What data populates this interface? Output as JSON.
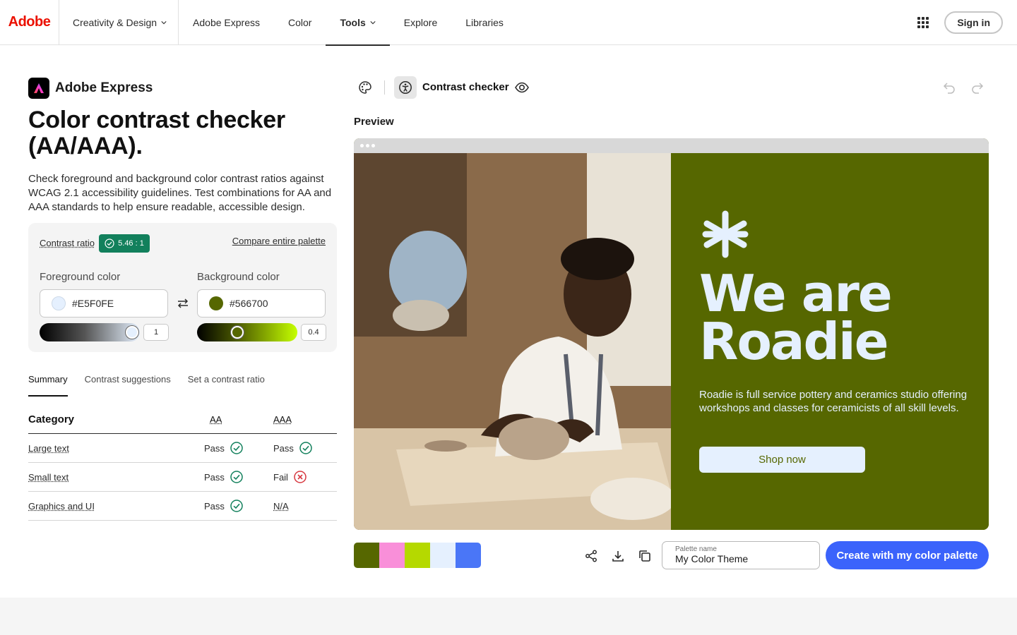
{
  "nav": {
    "logo": "Adobe",
    "items": [
      {
        "label": "Creativity & Design",
        "dropdown": true
      },
      {
        "label": "Adobe Express"
      },
      {
        "label": "Color"
      },
      {
        "label": "Tools",
        "dropdown": true,
        "active": true
      },
      {
        "label": "Explore"
      },
      {
        "label": "Libraries"
      }
    ],
    "apps_icon": "apps-grid-icon",
    "signin": "Sign in"
  },
  "left": {
    "brand": "Adobe Express",
    "title": "Color contrast checker (AA/AAA).",
    "description": "Check foreground and background color contrast ratios against WCAG 2.1 accessibility guidelines. Test combinations for AA and AAA standards to help ensure readable, accessible design."
  },
  "checker": {
    "ratio_label": "Contrast ratio",
    "ratio_value": "5.46 : 1",
    "compare_link": "Compare entire palette",
    "foreground": {
      "label": "Foreground color",
      "value": "#E5F0FE",
      "color": "#e5f0fe",
      "slider_value": "1"
    },
    "background": {
      "label": "Background color",
      "value": "#566700",
      "color": "#566700",
      "slider_value": "0.4"
    }
  },
  "tabs": [
    "Summary",
    "Contrast suggestions",
    "Set a contrast ratio"
  ],
  "results": {
    "headers": {
      "category": "Category",
      "aa": "AA",
      "aaa": "AAA"
    },
    "rows": [
      {
        "category": "Large text",
        "aa": "Pass",
        "aaa": "Pass"
      },
      {
        "category": "Small text",
        "aa": "Pass",
        "aaa": "Fail"
      },
      {
        "category": "Graphics and UI",
        "aa": "Pass",
        "aaa": "N/A"
      }
    ]
  },
  "toolbar": {
    "mode_label": "Contrast checker"
  },
  "preview": {
    "label": "Preview",
    "hero_line1": "We are",
    "hero_line2": "Roadie",
    "hero_body": "Roadie is full service pottery and ceramics studio offering workshops and classes for ceramicists of all skill levels.",
    "hero_button": "Shop now"
  },
  "palette": {
    "colors": [
      "#566700",
      "#f98fd9",
      "#b5d900",
      "#e5f0fe",
      "#4a76f7"
    ],
    "name_label": "Palette name",
    "name_value": "My Color Theme",
    "create_button": "Create with my color palette"
  },
  "colors": {
    "accent_blue": "#3b63fb",
    "pass_green": "#12805c",
    "fail_red": "#d7373f",
    "adobe_red": "#eb1000"
  }
}
